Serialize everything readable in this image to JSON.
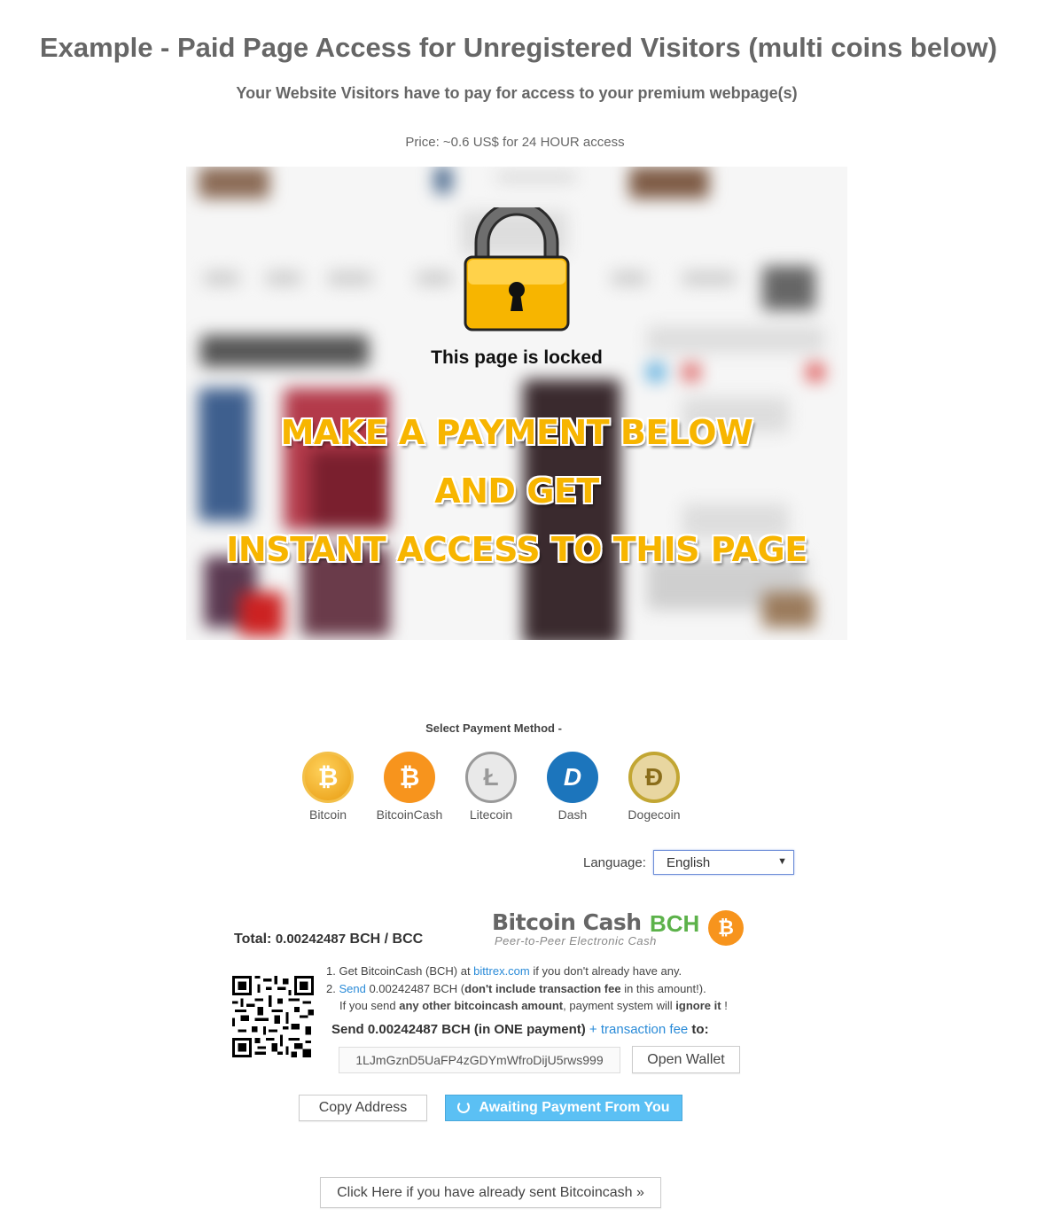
{
  "header": {
    "title": "Example - Paid Page Access for Unregistered Visitors (multi coins below)",
    "subtitle": "Your Website Visitors have to pay for access to your premium webpage(s)",
    "price": "Price: ~0.6 US$ for 24 HOUR access"
  },
  "locked_banner": {
    "locked_text": "This page is locked",
    "line1": "MAKE A PAYMENT BELOW",
    "line2": "AND  GET",
    "line3": "INSTANT ACCESS TO THIS PAGE",
    "accent_color": "#f7b500"
  },
  "payment_methods": {
    "label": "Select Payment Method -",
    "coins": [
      {
        "name": "Bitcoin",
        "icon": "bitcoin-icon",
        "symbol": "₿",
        "color": "#f0a81c"
      },
      {
        "name": "BitcoinCash",
        "icon": "bitcoincash-icon",
        "symbol": "₿",
        "color": "#f7941d"
      },
      {
        "name": "Litecoin",
        "icon": "litecoin-icon",
        "symbol": "Ł",
        "color": "#bfbfbf"
      },
      {
        "name": "Dash",
        "icon": "dash-icon",
        "symbol": "D",
        "color": "#1c75bc"
      },
      {
        "name": "Dogecoin",
        "icon": "dogecoin-icon",
        "symbol": "Ð",
        "color": "#c2a633"
      }
    ]
  },
  "language": {
    "label": "Language:",
    "selected": "English"
  },
  "payment_box": {
    "total_label": "Total:",
    "total_amount": "0.00242487",
    "total_unit": "BCH / BCC",
    "logo_word": "Bitcoin Cash",
    "logo_ticker": "BCH",
    "logo_tagline": "Peer-to-Peer Electronic Cash",
    "step1_prefix": "1. Get BitcoinCash (BCH) at ",
    "step1_link": "bittrex.com",
    "step1_suffix": " if you don't already have any.",
    "step2_prefix": "2. ",
    "step2_link": "Send",
    "step2_amount": " 0.00242487 BCH (",
    "step2_bold": "don't include transaction fee",
    "step2_suffix": " in this amount!).",
    "warn_prefix": "If you send ",
    "warn_bold1": "any other bitcoincash amount",
    "warn_mid": ", payment system will ",
    "warn_bold2": "ignore it",
    "warn_end": " !",
    "send_text": "Send 0.00242487 BCH (in ONE payment)",
    "send_fee": " + transaction fee",
    "send_to": " to:",
    "address": "1LJmGznD5UaFP4zGDYmWfroDijU5rws999",
    "open_wallet": "Open Wallet",
    "copy_address": "Copy Address",
    "awaiting": "Awaiting Payment From You",
    "already_sent": "Click Here if you have already sent Bitcoincash »"
  }
}
